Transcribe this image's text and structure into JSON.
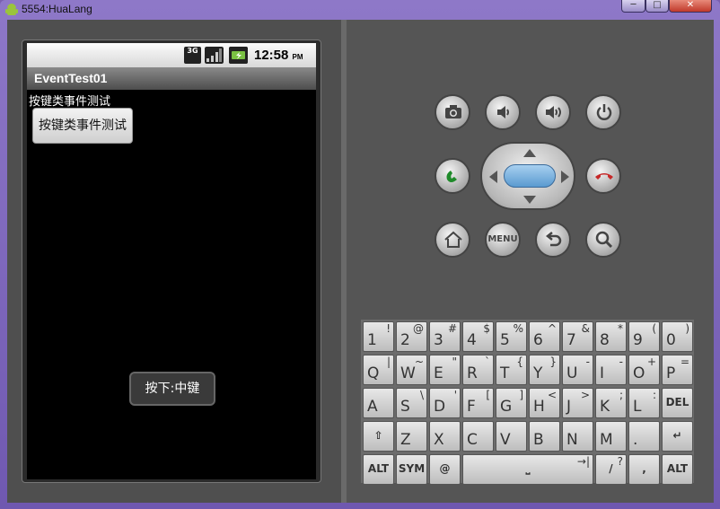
{
  "window": {
    "title": "5554:HuaLang",
    "minimize_label": "─",
    "maximize_label": "□",
    "close_label": "✕"
  },
  "statusbar": {
    "network_label": "3G",
    "time": "12:58",
    "ampm": "PM"
  },
  "app": {
    "title": "EventTest01",
    "label_text": "按键类事件测试",
    "button_label": "按键类事件测试",
    "toast_text": "按下:中键"
  },
  "controls": {
    "menu_label": "MENU",
    "camera_icon": "camera-icon",
    "volume_down_icon": "volume-down-icon",
    "volume_up_icon": "volume-up-icon",
    "power_icon": "power-icon",
    "call_icon": "call-icon",
    "end_call_icon": "end-call-icon",
    "home_icon": "home-icon",
    "back_icon": "back-icon",
    "search_icon": "search-icon"
  },
  "keyboard": {
    "rows": [
      [
        {
          "m": "1",
          "a": "!"
        },
        {
          "m": "2",
          "a": "@"
        },
        {
          "m": "3",
          "a": "#"
        },
        {
          "m": "4",
          "a": "$"
        },
        {
          "m": "5",
          "a": "%"
        },
        {
          "m": "6",
          "a": "^"
        },
        {
          "m": "7",
          "a": "&"
        },
        {
          "m": "8",
          "a": "*"
        },
        {
          "m": "9",
          "a": "("
        },
        {
          "m": "0",
          "a": ")"
        }
      ],
      [
        {
          "m": "Q",
          "a": "|"
        },
        {
          "m": "W",
          "a": "~"
        },
        {
          "m": "E",
          "a": "\""
        },
        {
          "m": "R",
          "a": "`"
        },
        {
          "m": "T",
          "a": "{"
        },
        {
          "m": "Y",
          "a": "}"
        },
        {
          "m": "U",
          "a": "-"
        },
        {
          "m": "I",
          "a": "-"
        },
        {
          "m": "O",
          "a": "+"
        },
        {
          "m": "P",
          "a": "="
        }
      ],
      [
        {
          "m": "A",
          "a": ""
        },
        {
          "m": "S",
          "a": "\\"
        },
        {
          "m": "D",
          "a": "'"
        },
        {
          "m": "F",
          "a": "["
        },
        {
          "m": "G",
          "a": "]"
        },
        {
          "m": "H",
          "a": "<"
        },
        {
          "m": "J",
          "a": ">"
        },
        {
          "m": "K",
          "a": ";"
        },
        {
          "m": "L",
          "a": ":"
        },
        {
          "m": "",
          "a": "",
          "c": "DEL"
        }
      ],
      [
        {
          "m": "",
          "a": "",
          "c": "⇧"
        },
        {
          "m": "Z",
          "a": ""
        },
        {
          "m": "X",
          "a": ""
        },
        {
          "m": "C",
          "a": ""
        },
        {
          "m": "V",
          "a": ""
        },
        {
          "m": "B",
          "a": ""
        },
        {
          "m": "N",
          "a": ""
        },
        {
          "m": "M",
          "a": ""
        },
        {
          "m": ".",
          "a": ""
        },
        {
          "m": "",
          "a": "",
          "c": "↵"
        }
      ]
    ],
    "bottom": {
      "alt_left": "ALT",
      "sym": "SYM",
      "at": "@",
      "space": "⎵",
      "slash": "/",
      "question": "?",
      "comma": ",",
      "alt_right": "ALT",
      "tab": "→|"
    }
  }
}
